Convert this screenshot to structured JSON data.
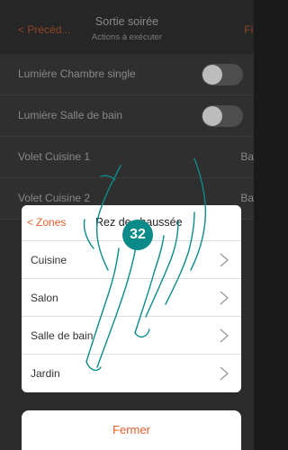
{
  "header": {
    "back_label": "Précéd...",
    "title": "Sortie soirée",
    "subtitle": "Actions à exécuter",
    "finish_label": "Fin"
  },
  "rows": [
    {
      "label": "Lumière Chambre single",
      "type": "toggle",
      "value": ""
    },
    {
      "label": "Lumière Salle de bain",
      "type": "toggle",
      "value": ""
    },
    {
      "label": "Volet Cuisine 1",
      "type": "value",
      "value": "Bas"
    },
    {
      "label": "Volet Cuisine 2",
      "type": "value",
      "value": "Bas"
    }
  ],
  "panel": {
    "back_label": "Zones",
    "title": "Rez de chaussée",
    "items": [
      "Cuisine",
      "Salon",
      "Salle de bain",
      "Jardin"
    ]
  },
  "close_label": "Fermer",
  "step_badge": "32",
  "colors": {
    "accent": "#e8602c",
    "badge": "#0b8a8a"
  }
}
